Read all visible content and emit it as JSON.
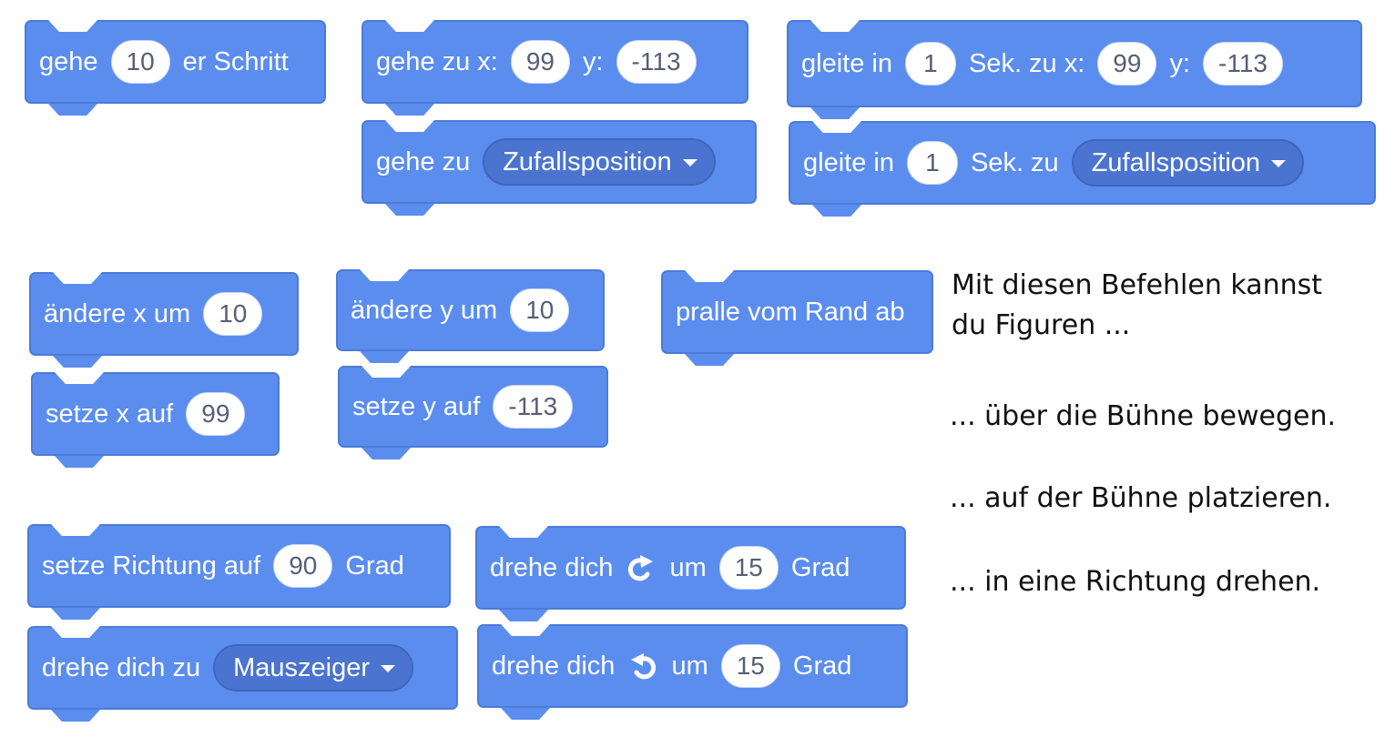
{
  "blocks": {
    "move": {
      "pre": "gehe",
      "steps": "10",
      "post": "er Schritt"
    },
    "goto_xy": {
      "pre": "gehe zu x:",
      "x": "99",
      "y_label": "y:",
      "y": "-113"
    },
    "goto_target": {
      "pre": "gehe zu",
      "menu": "Zufallsposition"
    },
    "glide_xy": {
      "pre": "gleite in",
      "secs": "1",
      "mid": "Sek. zu x:",
      "x": "99",
      "y_label": "y:",
      "y": "-113"
    },
    "glide_target": {
      "pre": "gleite in",
      "secs": "1",
      "mid": "Sek. zu",
      "menu": "Zufallsposition"
    },
    "change_x": {
      "pre": "ändere x um",
      "value": "10"
    },
    "set_x": {
      "pre": "setze x auf",
      "value": "99"
    },
    "change_y": {
      "pre": "ändere y um",
      "value": "10"
    },
    "set_y": {
      "pre": "setze y auf",
      "value": "-113"
    },
    "bounce": {
      "label": "pralle vom Rand ab"
    },
    "point_direction": {
      "pre": "setze Richtung auf",
      "value": "90",
      "post": "Grad"
    },
    "point_towards": {
      "pre": "drehe dich zu",
      "menu": "Mauszeiger"
    },
    "turn_right": {
      "pre": "drehe dich",
      "icon": "rotate-clockwise-icon",
      "mid": "um",
      "value": "15",
      "post": "Grad"
    },
    "turn_left": {
      "pre": "drehe dich",
      "icon": "rotate-counterclockwise-icon",
      "mid": "um",
      "value": "15",
      "post": "Grad"
    }
  },
  "description": {
    "intro_line1": "Mit diesen Befehlen kannst",
    "intro_line2": "du Figuren ...",
    "item1": "... über die Bühne bewegen.",
    "item2": "... auf der Bühne platzieren.",
    "item3": "... in eine Richtung drehen."
  },
  "colors": {
    "block": "#5b8def",
    "block_border": "#4c7bd6",
    "dropdown": "#4a74cf",
    "pill_text": "#575e75"
  }
}
